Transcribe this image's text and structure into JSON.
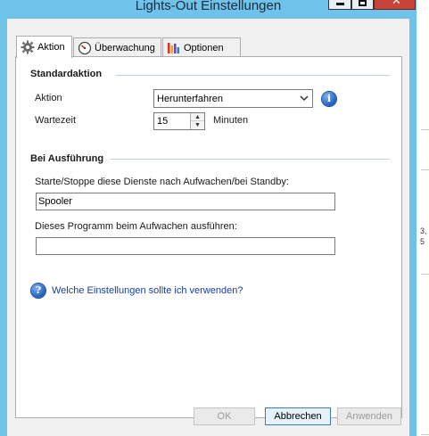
{
  "window": {
    "title": "Lights-Out Einstellungen",
    "close_glyph": "✕"
  },
  "tabs": [
    {
      "label": "Aktion",
      "icon": "gear-icon",
      "active": true
    },
    {
      "label": "Überwachung",
      "icon": "gauge-icon",
      "active": false
    },
    {
      "label": "Optionen",
      "icon": "bar-chart-icon",
      "active": false
    }
  ],
  "standardaktion": {
    "section_title": "Standardaktion",
    "aktion_label": "Aktion",
    "aktion_value": "Herunterfahren",
    "info_glyph": "i",
    "wartezeit_label": "Wartezeit",
    "wartezeit_value": "15",
    "wartezeit_unit": "Minuten"
  },
  "ausfuehrung": {
    "section_title": "Bei Ausführung",
    "dienste_label": "Starte/Stoppe diese Dienste nach Aufwachen/bei Standby:",
    "dienste_value": "Spooler",
    "programm_label": "Dieses Programm beim Aufwachen ausführen:",
    "programm_value": ""
  },
  "help": {
    "glyph": "?",
    "link_text": "Welche Einstellungen sollte ich verwenden?"
  },
  "buttons": {
    "ok": "OK",
    "cancel": "Abbrechen",
    "apply": "Anwenden"
  },
  "background": {
    "fragment1": "3,",
    "fragment2": "5"
  },
  "colors": {
    "title_bar": "#6fc3ea",
    "close_button": "#c7443a",
    "link": "#1a3da0",
    "section_line": "#b9d1e3"
  }
}
